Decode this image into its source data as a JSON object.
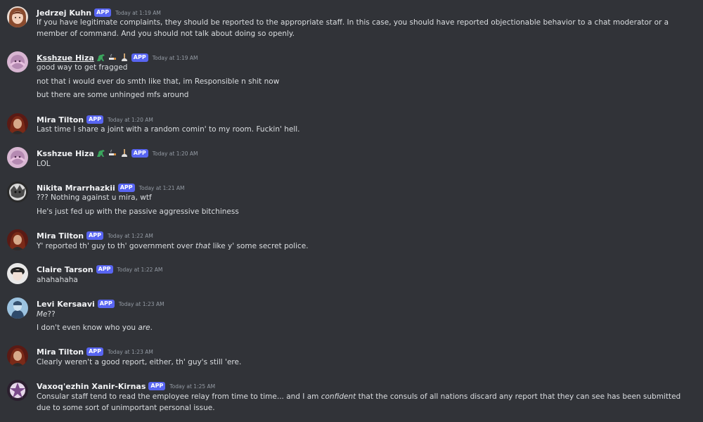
{
  "messages": [
    {
      "author": "Jedrzej Kuhn",
      "badge": "APP",
      "time": "Today at 1:19 AM",
      "lines": [
        {
          "parts": [
            {
              "t": "If you have legitimate complaints, they should be reported to the appropriate staff. In this case, you should have reported objectionable behavior to a chat moderator or a member of command. And you should not talk about doing so openly."
            }
          ]
        }
      ]
    },
    {
      "author": "Ksshzue Hiza",
      "badge": "APP",
      "time": "Today at 1:19 AM",
      "lines": [
        {
          "parts": [
            {
              "t": "good way to get fragged"
            }
          ]
        },
        {
          "parts": [
            {
              "t": "not that i would ever do smth like that, im Responsible n shit now"
            }
          ]
        },
        {
          "parts": [
            {
              "t": "but there are some unhinged mfs around"
            }
          ]
        }
      ]
    },
    {
      "author": "Mira Tilton",
      "badge": "APP",
      "time": "Today at 1:20 AM",
      "lines": [
        {
          "parts": [
            {
              "t": "Last time I share a joint with a random comin' to my room. Fuckin' hell."
            }
          ]
        }
      ]
    },
    {
      "author": "Ksshzue Hiza",
      "badge": "APP",
      "time": "Today at 1:20 AM",
      "lines": [
        {
          "parts": [
            {
              "t": "LOL"
            }
          ]
        }
      ]
    },
    {
      "author": "Nikita Mrarrhazkii",
      "badge": "APP",
      "time": "Today at 1:21 AM",
      "lines": [
        {
          "parts": [
            {
              "t": "??? Nothing against u mira, wtf"
            }
          ]
        },
        {
          "parts": [
            {
              "t": "He's just fed up with the passive aggressive bitchiness"
            }
          ]
        }
      ]
    },
    {
      "author": "Mira Tilton",
      "badge": "APP",
      "time": "Today at 1:22 AM",
      "lines": [
        {
          "parts": [
            {
              "t": "Y' reported th' guy to th' government over "
            },
            {
              "t": "that",
              "em": true
            },
            {
              "t": " like y' some secret police."
            }
          ]
        }
      ]
    },
    {
      "author": "Claire Tarson",
      "badge": "APP",
      "time": "Today at 1:22 AM",
      "lines": [
        {
          "parts": [
            {
              "t": "ahahahaha"
            }
          ]
        }
      ]
    },
    {
      "author": "Levi Kersaavi",
      "badge": "APP",
      "time": "Today at 1:23 AM",
      "lines": [
        {
          "parts": [
            {
              "t": "Me",
              "em": true
            },
            {
              "t": "??"
            }
          ]
        },
        {
          "parts": [
            {
              "t": "I don't even know who you "
            },
            {
              "t": "are",
              "em": true
            },
            {
              "t": "."
            }
          ]
        }
      ]
    },
    {
      "author": "Mira Tilton",
      "badge": "APP",
      "time": "Today at 1:23 AM",
      "lines": [
        {
          "parts": [
            {
              "t": "Clearly weren't a good report, either, th' guy's still 'ere."
            }
          ]
        }
      ]
    },
    {
      "author": "Vaxoq'ezhin Xanir-Kirnas",
      "badge": "APP",
      "time": "Today at 1:25 AM",
      "lines": [
        {
          "parts": [
            {
              "t": "Consular staff tend to read the employee relay from time to time... and I am "
            },
            {
              "t": "confident",
              "em": true
            },
            {
              "t": " that the consuls of all nations discard any report that they can see has been submitted due to some sort of unimportant personal issue."
            }
          ]
        }
      ]
    }
  ]
}
